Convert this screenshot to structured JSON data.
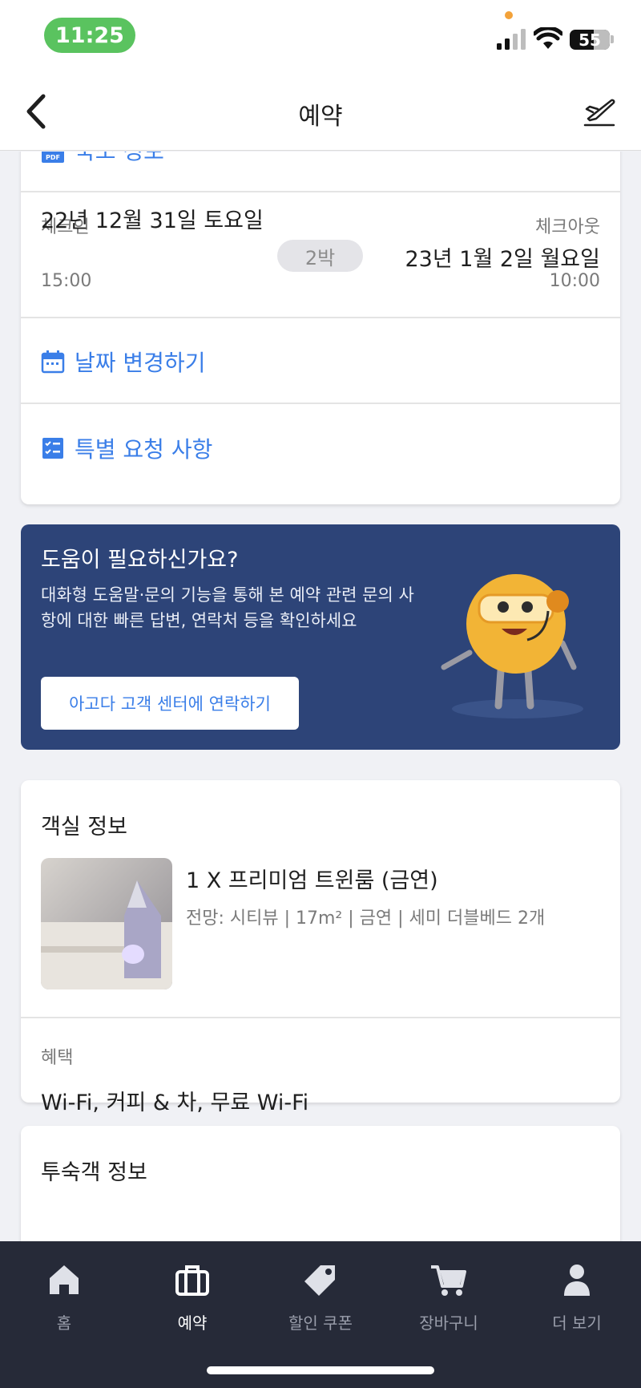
{
  "status_bar": {
    "time": "11:25",
    "battery": "55",
    "icons": [
      "signal-icon",
      "wifi-icon",
      "battery-icon"
    ]
  },
  "header": {
    "title": "예약",
    "back_icon": "chevron-left-icon",
    "right_icon": "airplane-icon"
  },
  "booking_card": {
    "property_info_link": "숙소 정보",
    "checkin": {
      "label": "체크인",
      "date": "22년 12월 31일 토요일",
      "time": "15:00"
    },
    "nights": "2박",
    "checkout": {
      "label": "체크아웃",
      "date": "23년 1월 2일 월요일",
      "time": "10:00"
    },
    "change_dates_link": "날짜 변경하기",
    "special_requests_link": "특별 요청 사항"
  },
  "help_card": {
    "title": "도움이 필요하신가요?",
    "description": "대화형 도움말·문의 기능을 통해 본 예약 관련 문의 사항에 대한 빠른 답변, 연락처 등을 확인하세요",
    "button": "아고다 고객 센터에 연락하기"
  },
  "room_card": {
    "title": "객실 정보",
    "room_name": "1 X 프리미엄 트윈룸 (금연)",
    "room_desc": "전망: 시티뷰 | 17m² | 금연 | 세미 더블베드 2개",
    "benefit_label": "혜택",
    "benefit_value": "Wi-Fi, 커피 & 차, 무료 Wi-Fi"
  },
  "guest_card": {
    "title": "투숙객 정보"
  },
  "bottom_nav": {
    "items": [
      {
        "label": "홈",
        "icon": "home-icon",
        "active": false
      },
      {
        "label": "예약",
        "icon": "suitcase-icon",
        "active": true
      },
      {
        "label": "할인 쿠폰",
        "icon": "tag-icon",
        "active": false
      },
      {
        "label": "장바구니",
        "icon": "cart-icon",
        "active": false
      },
      {
        "label": "더 보기",
        "icon": "person-icon",
        "active": false
      }
    ]
  },
  "colors": {
    "link_blue": "#3a7ee8",
    "help_bg": "#2d4478",
    "nav_bg": "#262a38",
    "status_green": "#5ac35f"
  }
}
